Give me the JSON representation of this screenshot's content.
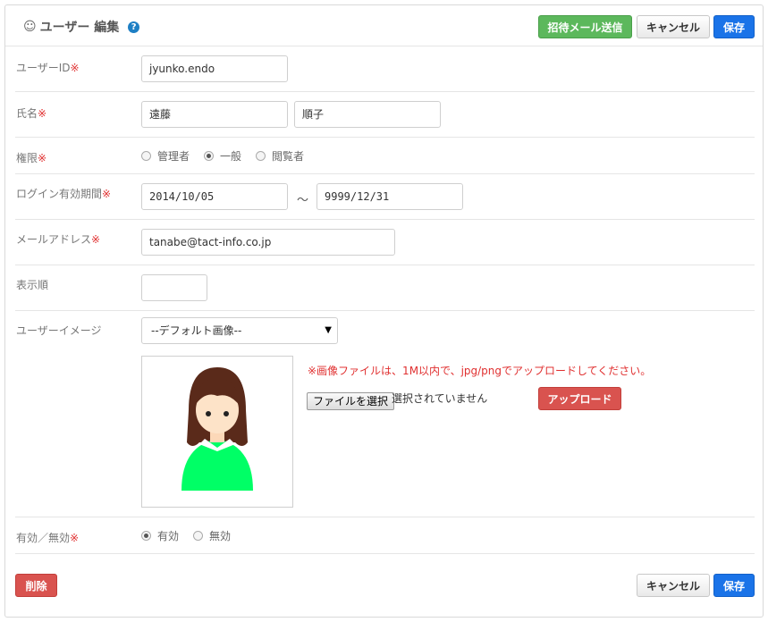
{
  "header": {
    "title": "ユーザー 編集",
    "invite_label": "招待メール送信",
    "cancel_label": "キャンセル",
    "save_label": "保存"
  },
  "fields": {
    "user_id": {
      "label": "ユーザーID",
      "required": "※",
      "value": "jyunko.endo"
    },
    "name": {
      "label": "氏名",
      "required": "※",
      "last": "遠藤",
      "first": "順子"
    },
    "role": {
      "label": "権限",
      "required": "※",
      "options": [
        "管理者",
        "一般",
        "閲覧者"
      ],
      "selected": "一般"
    },
    "login_period": {
      "label": "ログイン有効期間",
      "required": "※",
      "from": "2014/10/05",
      "separator": "～",
      "to": "9999/12/31"
    },
    "email": {
      "label": "メールアドレス",
      "required": "※",
      "value": "tanabe@tact-info.co.jp"
    },
    "display_order": {
      "label": "表示順",
      "value": ""
    },
    "user_image": {
      "label": "ユーザーイメージ",
      "select_value": "--デフォルト画像--",
      "note": "※画像ファイルは、1M以内で、jpg/pngでアップロードしてください。",
      "file_button": "ファイルを選択",
      "file_status": "選択されていません",
      "upload_label": "アップロード"
    },
    "status": {
      "label": "有効／無効",
      "required": "※",
      "options": [
        "有効",
        "無効"
      ],
      "selected": "有効"
    }
  },
  "footer": {
    "delete_label": "削除",
    "cancel_label": "キャンセル",
    "save_label": "保存"
  },
  "colors": {
    "invite": "#5cb85c",
    "primary": "#1a73e8",
    "danger": "#d9534f",
    "required": "#e03030",
    "avatar_shirt": "#00ff66",
    "avatar_hair": "#5a2a1a"
  }
}
